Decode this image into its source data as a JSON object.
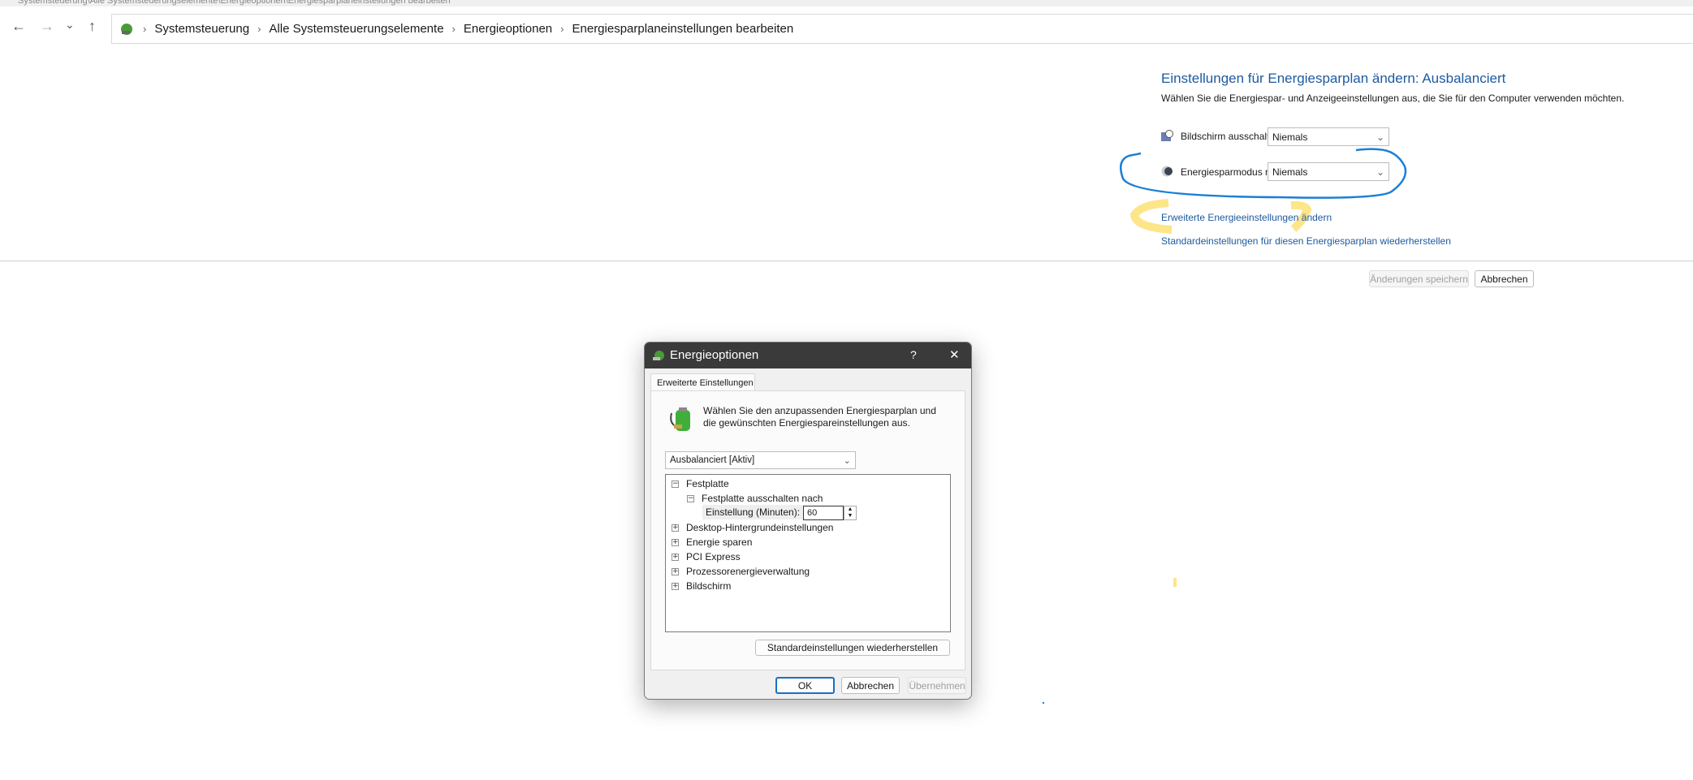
{
  "window": {
    "title": "Systemsteuerung\\Alle Systemsteuerungselemente\\Energieoptionen\\Energiesparplaneinstellungen bearbeiten"
  },
  "nav": {
    "back": "←",
    "forward": "→",
    "recent": "⌄",
    "up": "↑"
  },
  "breadcrumb": [
    "Systemsteuerung",
    "Alle Systemsteuerungselemente",
    "Energieoptionen",
    "Energiesparplaneinstellungen bearbeiten"
  ],
  "plan": {
    "heading": "Einstellungen für Energiesparplan ändern: Ausbalanciert",
    "description": "Wählen Sie die Energiespar- und Anzeigeeinstellungen aus, die Sie für den Computer verwenden möchten.",
    "display_off_label": "Bildschirm ausschalten:",
    "display_off_value": "Niemals",
    "sleep_label": "Energiesparmodus nach:",
    "sleep_value": "Niemals",
    "advanced_link": "Erweiterte Energieeinstellungen ändern",
    "restore_link": "Standardeinstellungen für diesen Energiesparplan wiederherstellen",
    "save_button": "Änderungen speichern",
    "cancel_button": "Abbrechen"
  },
  "annotation_colors": {
    "circle": "#1a7fd6",
    "highlight": "#fde58a"
  },
  "dialog": {
    "title": "Energieoptionen",
    "help": "?",
    "close": "✕",
    "tab": "Erweiterte Einstellungen",
    "intro": "Wählen Sie den anzupassenden Energiesparplan und die gewünschten Energiespareinstellungen aus.",
    "plan_select": "Ausbalanciert [Aktiv]",
    "tree": {
      "festplatte": "Festplatte",
      "festplatte_aus": "Festplatte ausschalten nach",
      "setting_label": "Einstellung (Minuten):",
      "setting_value": "60",
      "items": [
        "Desktop-Hintergrundeinstellungen",
        "Energie sparen",
        "PCI Express",
        "Prozessorenergieverwaltung",
        "Bildschirm"
      ]
    },
    "restore_button": "Standardeinstellungen wiederherstellen",
    "ok": "OK",
    "cancel": "Abbrechen",
    "apply": "Übernehmen"
  }
}
